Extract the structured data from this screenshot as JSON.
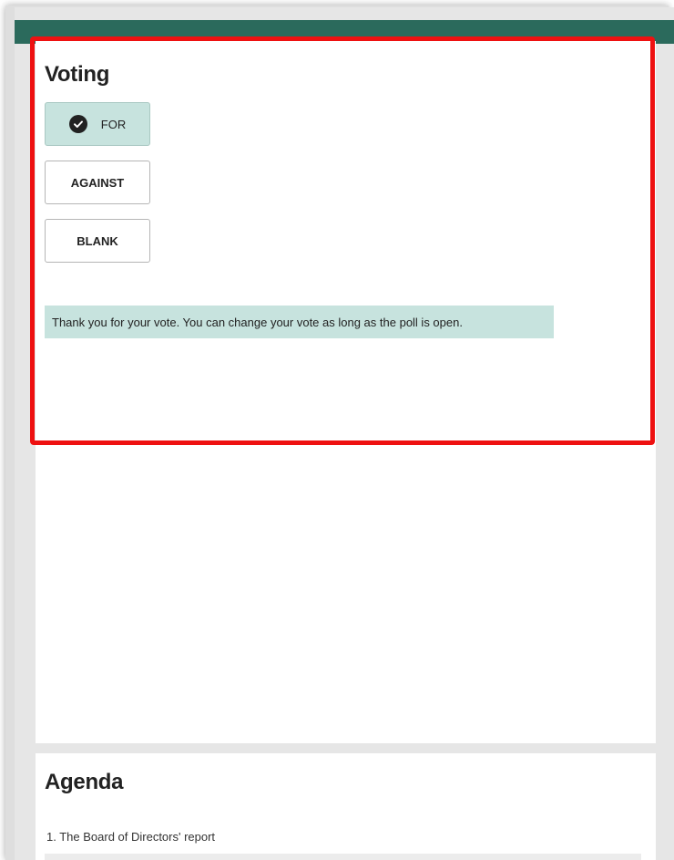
{
  "voting": {
    "title": "Voting",
    "options": [
      "FOR",
      "AGAINST",
      "BLANK"
    ],
    "selected": "FOR",
    "message": "Thank you for your vote. You can change your vote as long as the poll is open."
  },
  "agenda": {
    "title": "Agenda",
    "items": [
      "1. The Board of Directors' report"
    ]
  },
  "colors": {
    "header": "#2b6a5c",
    "selected": "#c7e3de",
    "highlight": "#ee1111"
  },
  "icons": {
    "selected_check": "check-circle-icon"
  }
}
